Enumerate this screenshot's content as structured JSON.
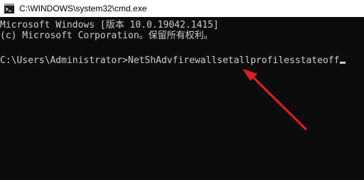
{
  "window": {
    "title": "C:\\WINDOWS\\system32\\cmd.exe",
    "icon": "cmd-icon"
  },
  "console": {
    "lines": [
      "Microsoft Windows [版本 10.0.19042.1415]",
      "(c) Microsoft Corporation。保留所有权利。"
    ],
    "prompt": "C:\\Users\\Administrator>",
    "command": "NetShAdvfirewallsetallprofilesstateoff"
  },
  "colors": {
    "console_bg": "#0c0c0c",
    "console_text": "#cccccc",
    "titlebar_bg": "#ffffff",
    "annotation_arrow": "#e0201c"
  }
}
